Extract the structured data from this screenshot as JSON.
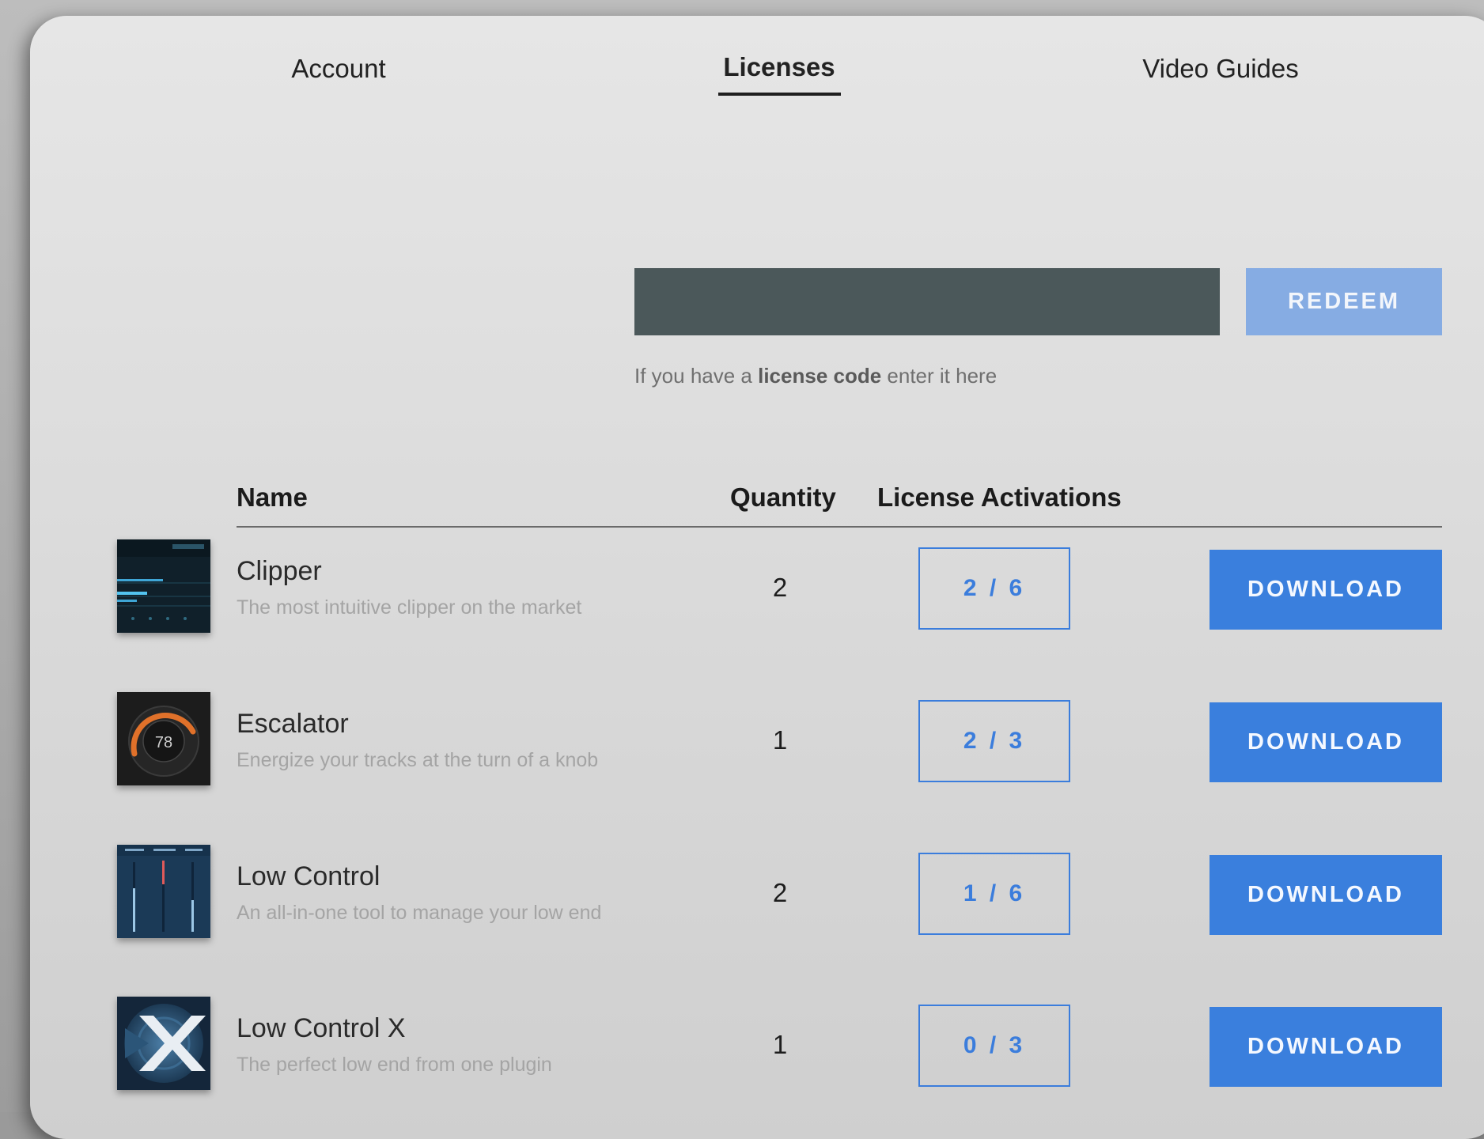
{
  "tabs": {
    "account": "Account",
    "licenses": "Licenses",
    "video_guides": "Video Guides"
  },
  "redeem": {
    "input_value": "",
    "button_label": "REDEEM",
    "hint_prefix": "If you have a ",
    "hint_bold": "license code",
    "hint_suffix": " enter it here"
  },
  "table": {
    "headers": {
      "name": "Name",
      "quantity": "Quantity",
      "activations": "License Activations"
    },
    "rows": [
      {
        "name": "Clipper",
        "description": "The most intuitive clipper on the market",
        "quantity": "2",
        "activations": "2 / 6",
        "download": "DOWNLOAD",
        "thumb_icon": "clipper-thumbnail-icon"
      },
      {
        "name": "Escalator",
        "description": "Energize your tracks at the turn of a knob",
        "quantity": "1",
        "activations": "2 / 3",
        "download": "DOWNLOAD",
        "thumb_icon": "escalator-thumbnail-icon",
        "thumb_text": "78"
      },
      {
        "name": "Low Control",
        "description": "An all-in-one tool to manage your low end",
        "quantity": "2",
        "activations": "1 / 6",
        "download": "DOWNLOAD",
        "thumb_icon": "low-control-thumbnail-icon"
      },
      {
        "name": "Low Control X",
        "description": "The perfect low end from one plugin",
        "quantity": "1",
        "activations": "0 / 3",
        "download": "DOWNLOAD",
        "thumb_icon": "low-control-x-thumbnail-icon"
      }
    ]
  },
  "colors": {
    "accent": "#3a7fdd",
    "redeem_disabled": "#86ace3",
    "input_bg": "#4b585a",
    "panel_bg": "#e3e3e3"
  }
}
